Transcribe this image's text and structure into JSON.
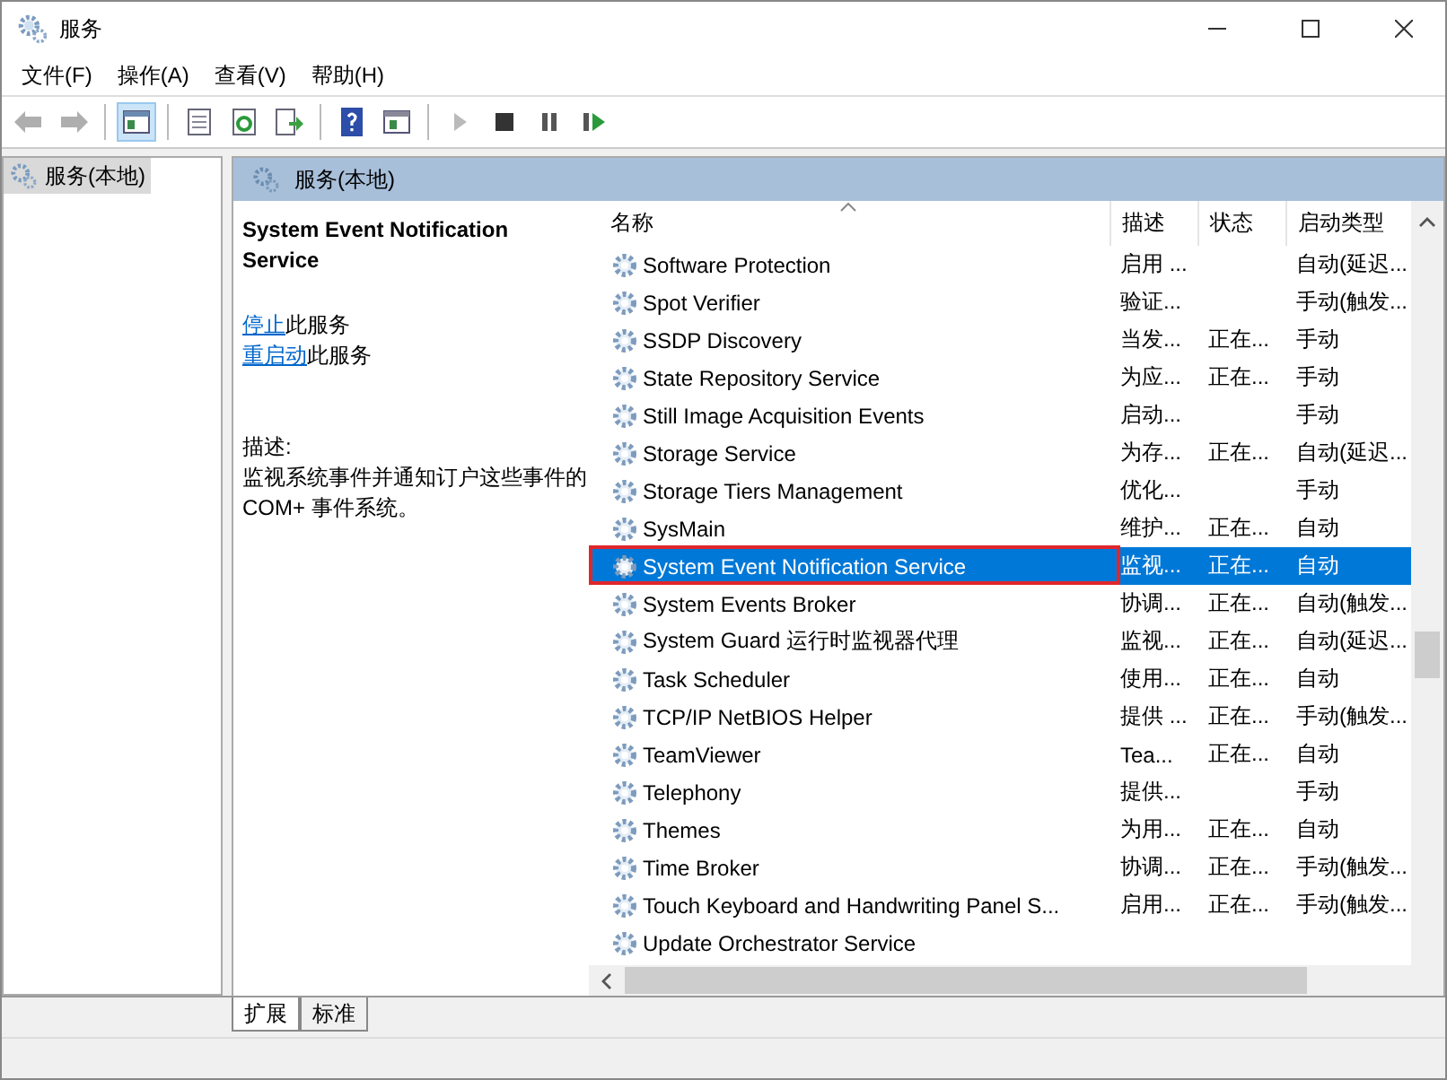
{
  "window": {
    "title": "服务"
  },
  "menu": [
    "文件(F)",
    "操作(A)",
    "查看(V)",
    "帮助(H)"
  ],
  "toolbar": [
    [
      {
        "kind": "back",
        "disabled": true,
        "selected": false
      },
      {
        "kind": "forward",
        "disabled": true,
        "selected": false
      }
    ],
    [
      {
        "kind": "tree",
        "disabled": false,
        "selected": true
      }
    ],
    [
      {
        "kind": "properties",
        "disabled": false,
        "selected": false
      },
      {
        "kind": "refresh",
        "disabled": false,
        "selected": false
      },
      {
        "kind": "export",
        "disabled": false,
        "selected": false
      }
    ],
    [
      {
        "kind": "help",
        "disabled": false,
        "selected": false
      },
      {
        "kind": "view",
        "disabled": false,
        "selected": false
      }
    ],
    [
      {
        "kind": "play",
        "disabled": true,
        "selected": false
      },
      {
        "kind": "stop",
        "disabled": false,
        "selected": false
      },
      {
        "kind": "pause",
        "disabled": false,
        "selected": false
      },
      {
        "kind": "resume",
        "disabled": false,
        "selected": false
      }
    ]
  ],
  "tree": [
    {
      "label": "服务(本地)",
      "selected": true
    }
  ],
  "pane_title": "服务(本地)",
  "detail": {
    "title": "System Event Notification Service",
    "actions": [
      {
        "link": "停止",
        "text": "此服务"
      },
      {
        "link": "重启动",
        "text": "此服务"
      }
    ],
    "description_label": "描述:",
    "description": "监视系统事件并通知订户这些事件的 COM+ 事件系统。"
  },
  "table": {
    "columns": [
      "名称",
      "描述",
      "状态",
      "启动类型"
    ],
    "rows": [
      {
        "name": "Software Protection",
        "description": "启用 ...",
        "status": "",
        "startup": "自动(延迟...",
        "selected": false,
        "highlighted": false
      },
      {
        "name": "Spot Verifier",
        "description": "验证...",
        "status": "",
        "startup": "手动(触发...",
        "selected": false,
        "highlighted": false
      },
      {
        "name": "SSDP Discovery",
        "description": "当发...",
        "status": "正在...",
        "startup": "手动",
        "selected": false,
        "highlighted": false
      },
      {
        "name": "State Repository Service",
        "description": "为应...",
        "status": "正在...",
        "startup": "手动",
        "selected": false,
        "highlighted": false
      },
      {
        "name": "Still Image Acquisition Events",
        "description": "启动...",
        "status": "",
        "startup": "手动",
        "selected": false,
        "highlighted": false
      },
      {
        "name": "Storage Service",
        "description": "为存...",
        "status": "正在...",
        "startup": "自动(延迟...",
        "selected": false,
        "highlighted": false
      },
      {
        "name": "Storage Tiers Management",
        "description": "优化...",
        "status": "",
        "startup": "手动",
        "selected": false,
        "highlighted": false
      },
      {
        "name": "SysMain",
        "description": "维护...",
        "status": "正在...",
        "startup": "自动",
        "selected": false,
        "highlighted": false
      },
      {
        "name": "System Event Notification Service",
        "description": "监视...",
        "status": "正在...",
        "startup": "自动",
        "selected": true,
        "highlighted": true
      },
      {
        "name": "System Events Broker",
        "description": "协调...",
        "status": "正在...",
        "startup": "自动(触发...",
        "selected": false,
        "highlighted": false
      },
      {
        "name": "System Guard 运行时监视器代理",
        "description": "监视...",
        "status": "正在...",
        "startup": "自动(延迟...",
        "selected": false,
        "highlighted": false
      },
      {
        "name": "Task Scheduler",
        "description": "使用...",
        "status": "正在...",
        "startup": "自动",
        "selected": false,
        "highlighted": false
      },
      {
        "name": "TCP/IP NetBIOS Helper",
        "description": "提供 ...",
        "status": "正在...",
        "startup": "手动(触发...",
        "selected": false,
        "highlighted": false
      },
      {
        "name": "TeamViewer",
        "description": "Tea...",
        "status": "正在...",
        "startup": "自动",
        "selected": false,
        "highlighted": false
      },
      {
        "name": "Telephony",
        "description": "提供...",
        "status": "",
        "startup": "手动",
        "selected": false,
        "highlighted": false
      },
      {
        "name": "Themes",
        "description": "为用...",
        "status": "正在...",
        "startup": "自动",
        "selected": false,
        "highlighted": false
      },
      {
        "name": "Time Broker",
        "description": "协调...",
        "status": "正在...",
        "startup": "手动(触发...",
        "selected": false,
        "highlighted": false
      },
      {
        "name": "Touch Keyboard and Handwriting Panel S...",
        "description": "启用...",
        "status": "正在...",
        "startup": "手动(触发...",
        "selected": false,
        "highlighted": false
      },
      {
        "name": "Update Orchestrator Service",
        "description": "",
        "status": "",
        "startup": "",
        "selected": false,
        "highlighted": false
      }
    ]
  },
  "tabs": [
    {
      "label": "扩展",
      "selected": true
    },
    {
      "label": "标准",
      "selected": false
    }
  ]
}
